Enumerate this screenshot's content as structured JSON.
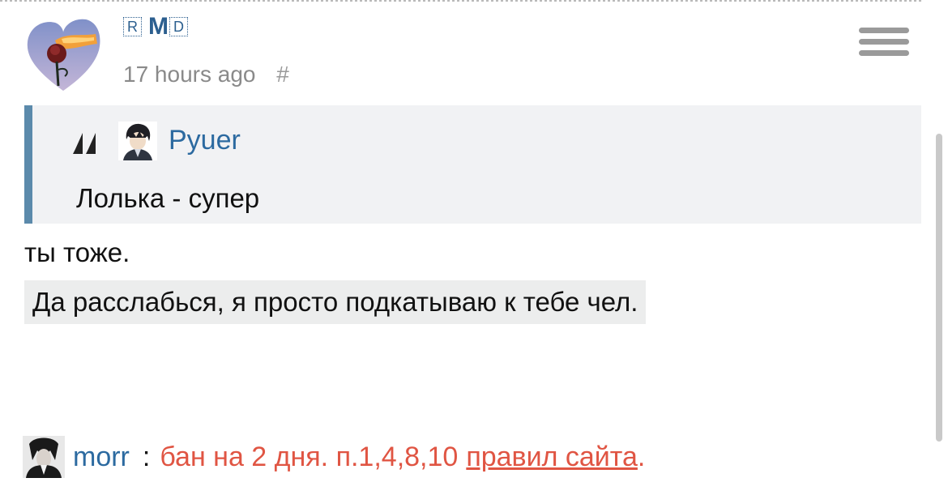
{
  "post": {
    "badges": {
      "r": "R",
      "m": "M",
      "d": "D"
    },
    "time": "17 hours ago",
    "hash": "#"
  },
  "quote": {
    "user": "Pyuer",
    "text": "Лолька - супер"
  },
  "reply": {
    "line1": "ты тоже.",
    "highlight": "Да расслабься, я просто подкатываю к тебе чел."
  },
  "moderation": {
    "user": "morr",
    "colon": ":",
    "ban_text": "бан на 2 дня. п.1,4,8,10",
    "link_text": "правил сайта",
    "end": "."
  },
  "colors": {
    "quote_border": "#5b8aab",
    "link_blue": "#2c6aa0",
    "ban_red": "#e05543"
  }
}
